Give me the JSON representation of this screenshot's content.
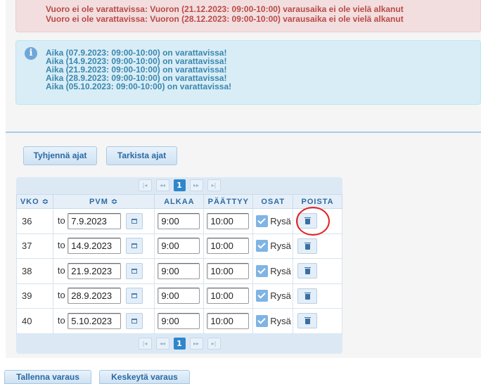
{
  "alerts": {
    "error_lines": [
      "Vuoro ei ole varattavissa: Vuoron (21.12.2023: 09:00-10:00) varausaika ei ole vielä alkanut",
      "Vuoro ei ole varattavissa: Vuoron (28.12.2023: 09:00-10:00) varausaika ei ole vielä alkanut"
    ],
    "info_icon": "i",
    "info_lines": [
      "Aika (07.9.2023: 09:00-10:00) on varattavissa!",
      "Aika (14.9.2023: 09:00-10:00) on varattavissa!",
      "Aika (21.9.2023: 09:00-10:00) on varattavissa!",
      "Aika (28.9.2023: 09:00-10:00) on varattavissa!",
      "Aika (05.10.2023: 09:00-10:00) on varattavissa!"
    ]
  },
  "actions": {
    "clear_label": "Tyhjennä ajat",
    "check_label": "Tarkista ajat",
    "save_label": "Tallenna varaus",
    "cancel_label": "Keskeytä varaus"
  },
  "pager": {
    "first": "|◂",
    "prev": "◂◂",
    "page": "1",
    "next": "▸▸",
    "last": "▸|"
  },
  "table": {
    "headers": {
      "vko": "VKO ≎",
      "pvm": "PVM ≎",
      "alkaa": "ALKAA",
      "paattyy": "PÄÄTTYY",
      "osat": "OSAT",
      "poista": "POISTA"
    },
    "rows": [
      {
        "vko": "36",
        "day": "to",
        "date": "7.9.2023",
        "start": "9:00",
        "end": "10:00",
        "part": "Rysä"
      },
      {
        "vko": "37",
        "day": "to",
        "date": "14.9.2023",
        "start": "9:00",
        "end": "10:00",
        "part": "Rysä"
      },
      {
        "vko": "38",
        "day": "to",
        "date": "21.9.2023",
        "start": "9:00",
        "end": "10:00",
        "part": "Rysä"
      },
      {
        "vko": "39",
        "day": "to",
        "date": "28.9.2023",
        "start": "9:00",
        "end": "10:00",
        "part": "Rysä"
      },
      {
        "vko": "40",
        "day": "to",
        "date": "5.10.2023",
        "start": "9:00",
        "end": "10:00",
        "part": "Rysä"
      }
    ]
  },
  "colors": {
    "error_text": "#b94a48",
    "info_text": "#3a87ad",
    "highlight_circle": "#e32222"
  }
}
